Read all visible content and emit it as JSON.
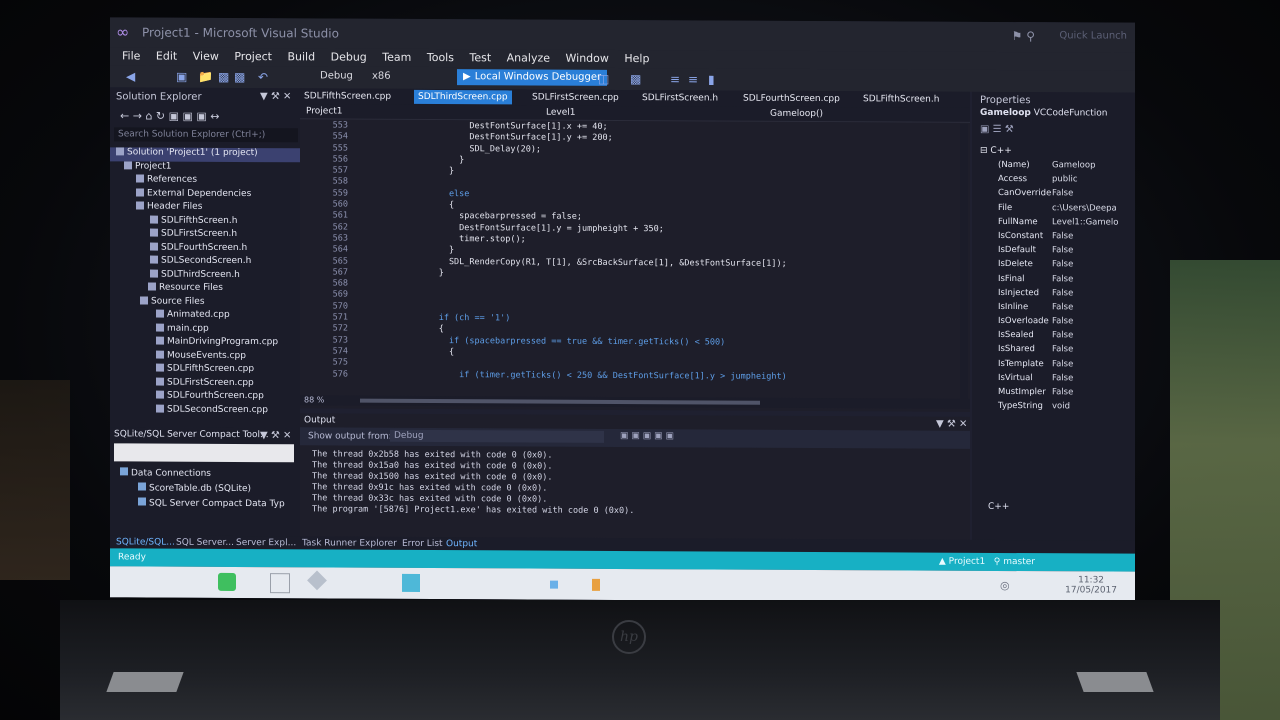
{
  "window": {
    "title": "Project1 - Microsoft Visual Studio",
    "quick_launch": "Quick Launch"
  },
  "menu": [
    "File",
    "Edit",
    "View",
    "Project",
    "Build",
    "Debug",
    "Team",
    "Tools",
    "Test",
    "Analyze",
    "Window",
    "Help"
  ],
  "toolbar": {
    "config": "Debug",
    "platform": "x86",
    "run_label": "Local Windows Debugger"
  },
  "solution_explorer": {
    "title": "Solution Explorer",
    "search_placeholder": "Search Solution Explorer (Ctrl+;)",
    "items": [
      "Solution 'Project1' (1 project)",
      "Project1",
      "References",
      "External Dependencies",
      "Header Files",
      "SDLFifthScreen.h",
      "SDLFirstScreen.h",
      "SDLFourthScreen.h",
      "SDLSecondScreen.h",
      "SDLThirdScreen.h",
      "Resource Files",
      "Source Files",
      "Animated.cpp",
      "main.cpp",
      "MainDrivingProgram.cpp",
      "MouseEvents.cpp",
      "SDLFifthScreen.cpp",
      "SDLFirstScreen.cpp",
      "SDLFourthScreen.cpp",
      "SDLSecondScreen.cpp"
    ]
  },
  "sql_panel": {
    "title": "SQLite/SQL Server Compact Tool...",
    "items": [
      "Data Connections",
      "ScoreTable.db (SQLite)",
      "SQL Server Compact Data Typ"
    ]
  },
  "editor": {
    "tabs": [
      "SDLFifthScreen.cpp",
      "SDLThirdScreen.cpp",
      "SDLFirstScreen.cpp",
      "SDLFirstScreen.h",
      "SDLFourthScreen.cpp",
      "SDLFifthScreen.h"
    ],
    "nav_project": "Project1",
    "nav_scope": "Level1",
    "nav_member": "Gameloop()",
    "zoom": "88 %",
    "lines": [
      {
        "n": "553",
        "code": "            DestFontSurface[1].x += 40;"
      },
      {
        "n": "554",
        "code": "            DestFontSurface[1].y += 200;"
      },
      {
        "n": "555",
        "code": "            SDL_Delay(20);"
      },
      {
        "n": "556",
        "code": "          }"
      },
      {
        "n": "557",
        "code": "        }"
      },
      {
        "n": "558",
        "code": ""
      },
      {
        "n": "559",
        "code": "        else"
      },
      {
        "n": "560",
        "code": "        {"
      },
      {
        "n": "561",
        "code": "          spacebarpressed = false;"
      },
      {
        "n": "562",
        "code": "          DestFontSurface[1].y = jumpheight + 350;"
      },
      {
        "n": "563",
        "code": "          timer.stop();"
      },
      {
        "n": "564",
        "code": "        }"
      },
      {
        "n": "565",
        "code": "        SDL_RenderCopy(R1, T[1], &SrcBackSurface[1], &DestFontSurface[1]);"
      },
      {
        "n": "567",
        "code": "      }"
      },
      {
        "n": "568",
        "code": ""
      },
      {
        "n": "569",
        "code": ""
      },
      {
        "n": "570",
        "code": ""
      },
      {
        "n": "571",
        "code": "      if (ch == '1')"
      },
      {
        "n": "572",
        "code": "      {"
      },
      {
        "n": "573",
        "code": "        if (spacebarpressed == true && timer.getTicks() < 500)"
      },
      {
        "n": "574",
        "code": "        {"
      },
      {
        "n": "575",
        "code": ""
      },
      {
        "n": "576",
        "code": "          if (timer.getTicks() < 250 && DestFontSurface[1].y > jumpheight)"
      }
    ]
  },
  "output": {
    "title": "Output",
    "show_label": "Show output from:",
    "source": "Debug",
    "lines": [
      "The thread 0x2b58 has exited with code 0 (0x0).",
      "The thread 0x15a0 has exited with code 0 (0x0).",
      "The thread 0x1500 has exited with code 0 (0x0).",
      "The thread 0x91c has exited with code 0 (0x0).",
      "The thread 0x33c has exited with code 0 (0x0).",
      "The program '[5876] Project1.exe' has exited with code 0 (0x0)."
    ]
  },
  "properties": {
    "title": "Properties",
    "subject": "Gameloop",
    "subject_type": "VCCodeFunction",
    "category": "C++",
    "rows": [
      {
        "k": "(Name)",
        "v": "Gameloop"
      },
      {
        "k": "Access",
        "v": "public"
      },
      {
        "k": "CanOverride",
        "v": "False"
      },
      {
        "k": "File",
        "v": "c:\\Users\\Deepa"
      },
      {
        "k": "FullName",
        "v": "Level1::Gamelo"
      },
      {
        "k": "IsConstant",
        "v": "False"
      },
      {
        "k": "IsDefault",
        "v": "False"
      },
      {
        "k": "IsDelete",
        "v": "False"
      },
      {
        "k": "IsFinal",
        "v": "False"
      },
      {
        "k": "IsInjected",
        "v": "False"
      },
      {
        "k": "IsInline",
        "v": "False"
      },
      {
        "k": "IsOverloade",
        "v": "False"
      },
      {
        "k": "IsSealed",
        "v": "False"
      },
      {
        "k": "IsShared",
        "v": "False"
      },
      {
        "k": "IsTemplate",
        "v": "False"
      },
      {
        "k": "IsVirtual",
        "v": "False"
      },
      {
        "k": "MustImpler",
        "v": "False"
      },
      {
        "k": "TypeString",
        "v": "void"
      }
    ],
    "footer": "C++"
  },
  "bottom_tabs": [
    "SQLite/SQL...",
    "SQL Server...",
    "Server Expl...",
    "Task Runner Explorer",
    "Error List",
    "Output"
  ],
  "status": {
    "left": "Ready",
    "right": "Project1",
    "branch": "master"
  },
  "clock": {
    "time": "11:32",
    "date": "17/05/2017"
  }
}
